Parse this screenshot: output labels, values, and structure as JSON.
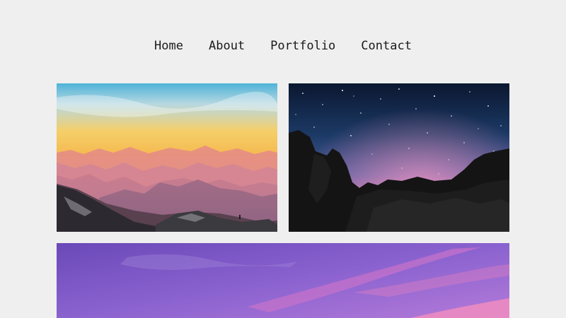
{
  "nav": {
    "items": [
      {
        "label": "Home"
      },
      {
        "label": "About"
      },
      {
        "label": "Portfolio"
      },
      {
        "label": "Contact"
      }
    ]
  },
  "gallery": {
    "images": [
      {
        "icon": "mountain-sunset-photo"
      },
      {
        "icon": "starry-night-rocks-photo"
      },
      {
        "icon": "purple-sky-photo"
      }
    ]
  }
}
